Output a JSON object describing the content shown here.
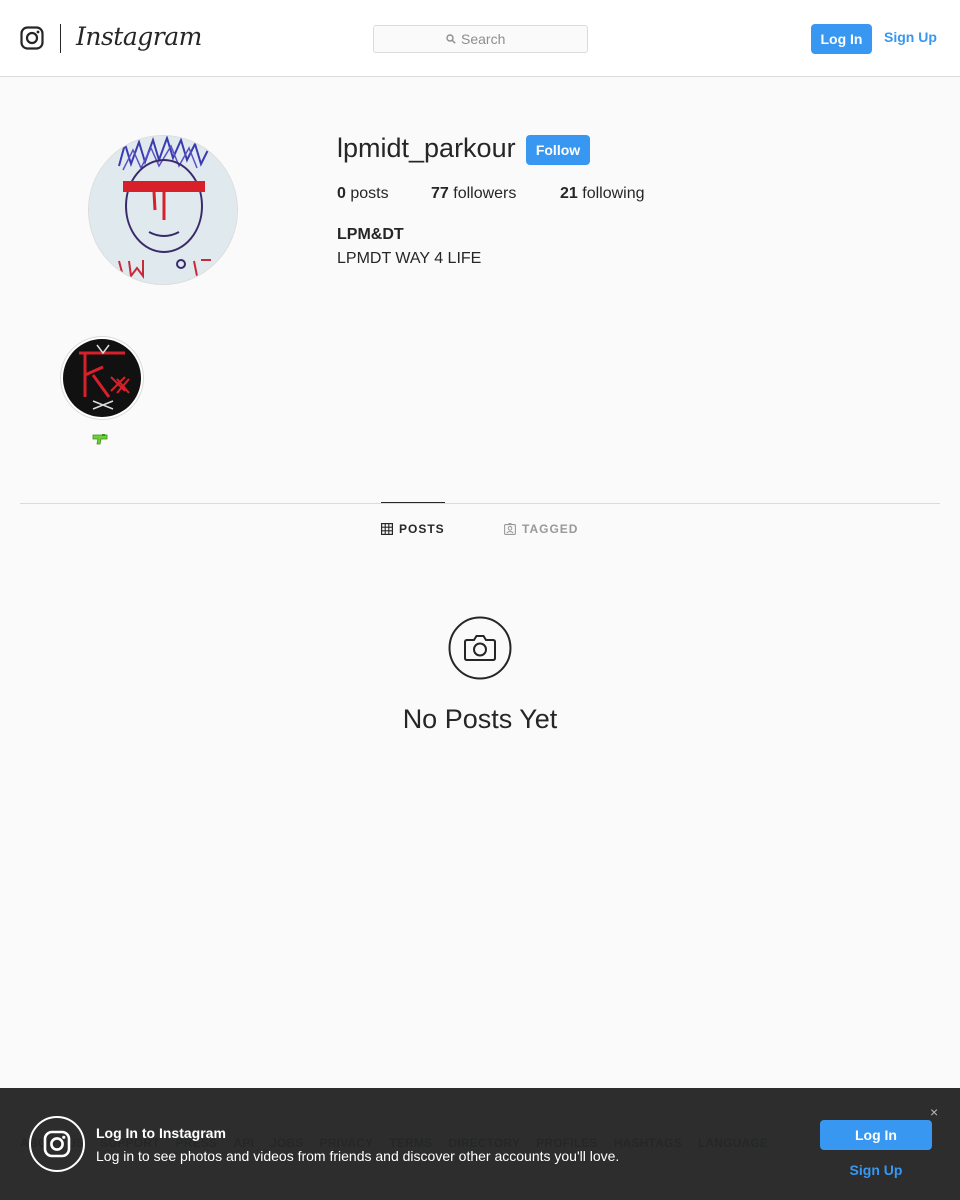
{
  "nav": {
    "wordmark": "Instagram",
    "search_placeholder": "Search",
    "login_label": "Log In",
    "signup_label": "Sign Up"
  },
  "profile": {
    "username": "lpmidt_parkour",
    "follow_label": "Follow",
    "stats": {
      "posts_count": "0",
      "posts_label": "posts",
      "followers_count": "77",
      "followers_label": "followers",
      "following_count": "21",
      "following_label": "following"
    },
    "full_name": "LPM&DT",
    "bio": "LPMDT WAY 4 LIFE"
  },
  "highlights": [
    {
      "label_icon": "water-gun-emoji-icon"
    }
  ],
  "tabs": [
    {
      "label": "POSTS",
      "icon": "grid-icon",
      "active": true
    },
    {
      "label": "TAGGED",
      "icon": "tag-portrait-icon",
      "active": false
    }
  ],
  "empty_state": {
    "text": "No Posts Yet",
    "icon": "camera-icon"
  },
  "footer": {
    "links": [
      "ABOUT US",
      "SUPPORT",
      "PRESS",
      "API",
      "JOBS",
      "PRIVACY",
      "TERMS",
      "DIRECTORY",
      "PROFILES",
      "HASHTAGS",
      "LANGUAGE"
    ]
  },
  "login_banner": {
    "title": "Log In to Instagram",
    "subtitle": "Log in to see photos and videos from friends and discover other accounts you'll love.",
    "login_label": "Log In",
    "signup_label": "Sign Up",
    "close_glyph": "×"
  },
  "colors": {
    "accent": "#3897f0",
    "text": "#262626",
    "border": "#dbdbdb",
    "background": "#fafafa",
    "banner_bg": "#262626"
  }
}
